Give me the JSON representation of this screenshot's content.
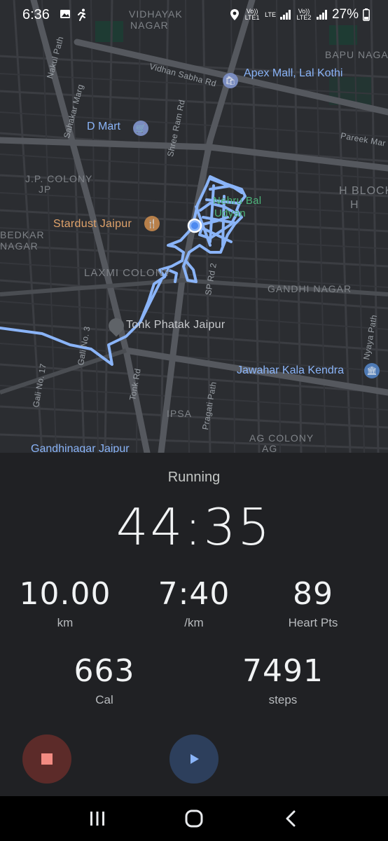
{
  "status_bar": {
    "time": "6:36",
    "sim1": "Vo)) LTE1",
    "lte": "LTE",
    "sim2": "Vo)) LTE2",
    "battery": "27%"
  },
  "map": {
    "labels": {
      "vidhayak": "VIDHAYAK",
      "nagar": "NAGAR",
      "bapu_nagar": "BAPU NAGAR",
      "apex_mall": "Apex Mall, Lal Kothi",
      "vidhan_sabha": "Vidhan Sabha Rd",
      "nakul_path": "Nakul Path",
      "sahakar_marg": "Sahakar Marg",
      "dmart": "D Mart",
      "shree_ram": "Shree Ram Rd",
      "pareek": "Pareek Mar",
      "jp_colony": "J.P. COLONY",
      "jp": "JP",
      "h_block": "H BLOCK",
      "h": "H",
      "nehru_bal_1": "Nehru Bal",
      "nehru_bal_2": "Udyan",
      "stardust": "Stardust Jaipur",
      "bedkar": "BEDKAR",
      "nagar2": "NAGAR",
      "laxmi_colony": "LAXMI COLONY",
      "sp_rd": "SP Rd 2",
      "gandhi_nagar": "GANDHI NAGAR",
      "tonk_phatak": "Tonk Phatak Jaipur",
      "nyaya_path": "Nyaya Path",
      "gali3": "Gali No. 3",
      "gali17": "Gali No. 17",
      "jawahar": "Jawahar Kala Kendra",
      "tonk_rd": "Tonk Rd",
      "ipsa": "IPSA",
      "pragati": "Pragati Path",
      "ag_colony": "AG COLONY",
      "ag": "AG",
      "gandhinagar_jaipur": "Gandhinagar Jaipur"
    }
  },
  "workout": {
    "activity": "Running",
    "elapsed": "44:35",
    "distance_value": "10.00",
    "distance_unit": "km",
    "pace_value": "7:40",
    "pace_unit": "/km",
    "heart_value": "89",
    "heart_unit": "Heart Pts",
    "cal_value": "663",
    "cal_unit": "Cal",
    "steps_value": "7491",
    "steps_unit": "steps"
  },
  "colors": {
    "route": "#8ab4f8",
    "stop_bg": "#5c2b29",
    "stop_fg": "#f28b82",
    "play_bg": "#2d3f5c",
    "play_fg": "#8ab4f8"
  }
}
